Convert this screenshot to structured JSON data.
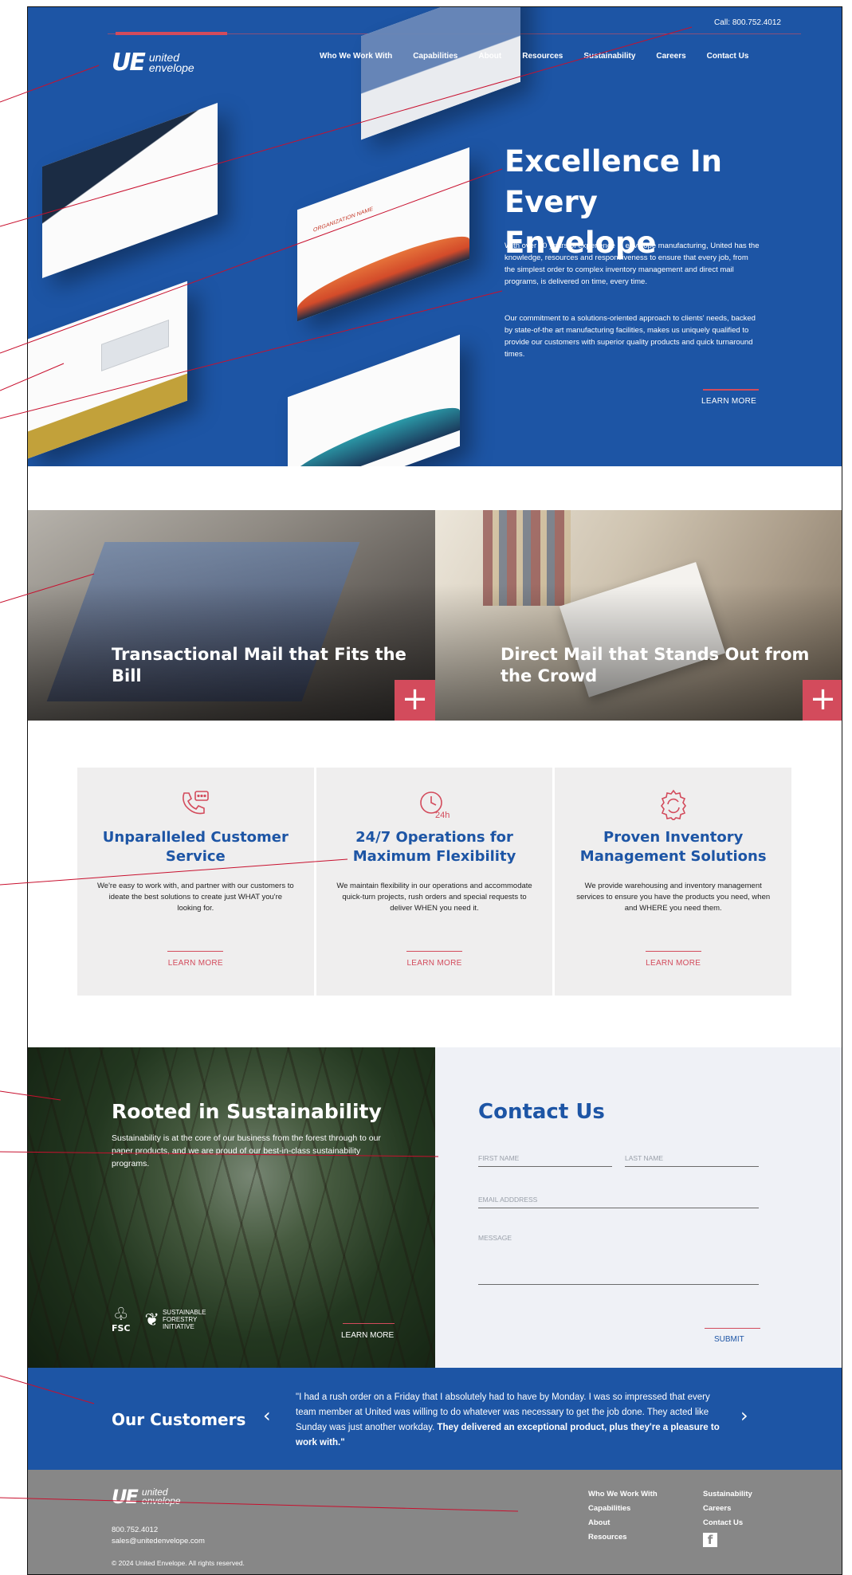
{
  "header": {
    "phone": "Call: 800.752.4012",
    "logo_mark": "UE",
    "logo_line1": "united",
    "logo_line2": "envelope",
    "nav": [
      "Who We Work With",
      "Capabilities",
      "About",
      "Resources",
      "Sustainability",
      "Careers",
      "Contact Us"
    ]
  },
  "hero": {
    "title": "Excellence In Every Envelope",
    "paragraph1": "With over 90 years of experience in envelope manufacturing, United has the knowledge, resources and responsiveness to ensure that every job, from the simplest order to complex inventory management and direct mail programs, is delivered on time, every time.",
    "paragraph2": "Our commitment to a solutions-oriented approach to clients' needs, backed by state-of-the art manufacturing facilities, makes us uniquely qualified to provide our customers with superior quality products and quick turnaround times.",
    "learn_more": "LEARN MORE",
    "envelope_address": "ORGANIZATION NAME"
  },
  "panels": [
    {
      "title": "Transactional Mail that Fits the Bill",
      "button": "+"
    },
    {
      "title": "Direct Mail that Stands Out from the Crowd",
      "button": "+"
    }
  ],
  "features": [
    {
      "icon": "phone-chat-icon",
      "title": "Unparalleled Customer Service",
      "text": "We're easy to work with, and partner with our customers to ideate the best solutions to create just WHAT you're looking for.",
      "link": "LEARN MORE"
    },
    {
      "icon": "clock-24h-icon",
      "icon_label": "24h",
      "title": "24/7 Operations for Maximum Flexibility",
      "text": "We maintain flexibility in our operations and accommodate quick-turn projects, rush orders and special requests to deliver WHEN you need it.",
      "link": "LEARN MORE"
    },
    {
      "icon": "gear-cycle-icon",
      "title": "Proven Inventory Management Solutions",
      "text": "We provide warehousing and inventory management services to ensure you have the products you need, when and WHERE you need them.",
      "link": "LEARN MORE"
    }
  ],
  "sustainability": {
    "title": "Rooted in Sustainability",
    "text": "Sustainability is at the core of our business from the forest through to our paper products, and we are proud of our best-in-class sustainability programs.",
    "fsc": "FSC",
    "sfi_line1": "SUSTAINABLE",
    "sfi_line2": "FORESTRY",
    "sfi_line3": "INITIATIVE",
    "learn_more": "LEARN MORE"
  },
  "contact": {
    "title": "Contact Us",
    "first_name": "FIRST NAME",
    "last_name": "LAST NAME",
    "email": "EMAIL ADDDRESS",
    "message": "MESSAGE",
    "submit": "SUBMIT"
  },
  "customers": {
    "title": "Our Customers",
    "prev": "‹",
    "next": "›",
    "quote_plain": "\"I had a rush order on a Friday that I absolutely had to have by Monday. I was so impressed that every team member at United was willing to do whatever was necessary to get the job done. They acted like Sunday was just another workday.",
    "quote_bold": "They delivered an exceptional product, plus they're a pleasure to work with.\""
  },
  "footer": {
    "phone": "800.752.4012",
    "email": "sales@unitedenvelope.com",
    "copyright": "© 2024 United Envelope. All rights reserved.",
    "col1": [
      "Who We Work With",
      "Capabilities",
      "About",
      "Resources"
    ],
    "col2": [
      "Sustainability",
      "Careers",
      "Contact Us"
    ],
    "facebook": "f"
  },
  "colors": {
    "brand_blue": "#1d55a5",
    "accent_red": "#d34b5c",
    "annotation_red": "#c8102e",
    "footer_gray": "#878787"
  }
}
